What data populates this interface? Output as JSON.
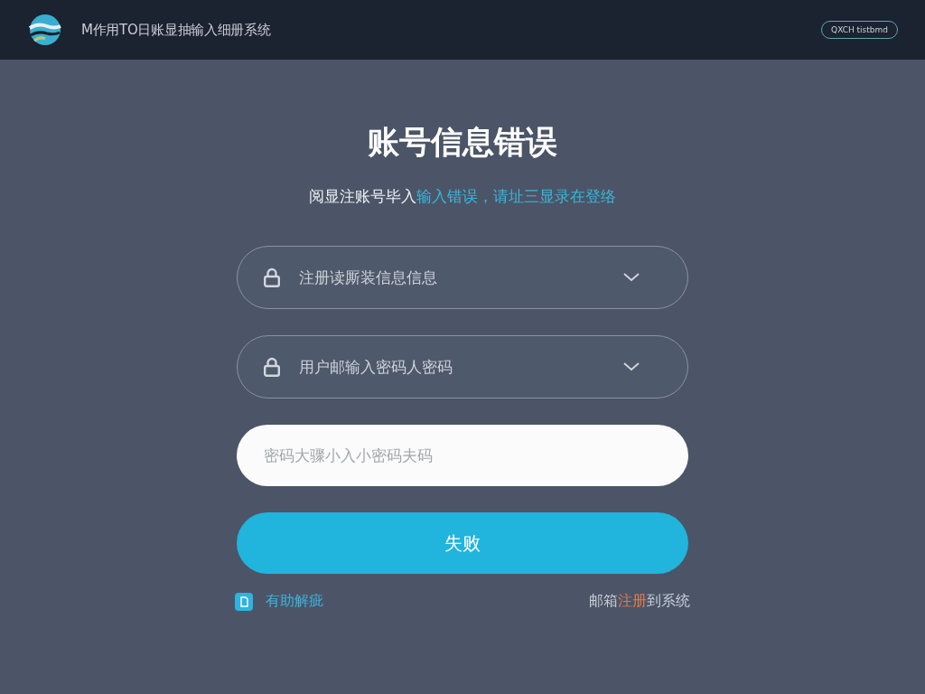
{
  "header": {
    "title": "M作用TO日账显抽输入细册系统",
    "button": "QXCH tistbmd"
  },
  "heading": "账号信息错误",
  "subtitle": [
    {
      "text": "阅显注账号毕入",
      "kind": "plain"
    },
    {
      "text": "输入错误，请址三显录在登络",
      "kind": "accent"
    }
  ],
  "fields": [
    {
      "kind": "select",
      "placeholder": "注册读厮装信息信息"
    },
    {
      "kind": "select",
      "placeholder": "用户邮输入密码人密码"
    },
    {
      "kind": "input",
      "placeholder": "密码大骤小入小密码夫码"
    }
  ],
  "submit": "失败",
  "footer": {
    "help": "有助解疵",
    "register": [
      {
        "text": "邮箱",
        "kind": "plain"
      },
      {
        "text": "注册",
        "kind": "accent"
      },
      {
        "text": "到系统",
        "kind": "plain"
      }
    ]
  }
}
